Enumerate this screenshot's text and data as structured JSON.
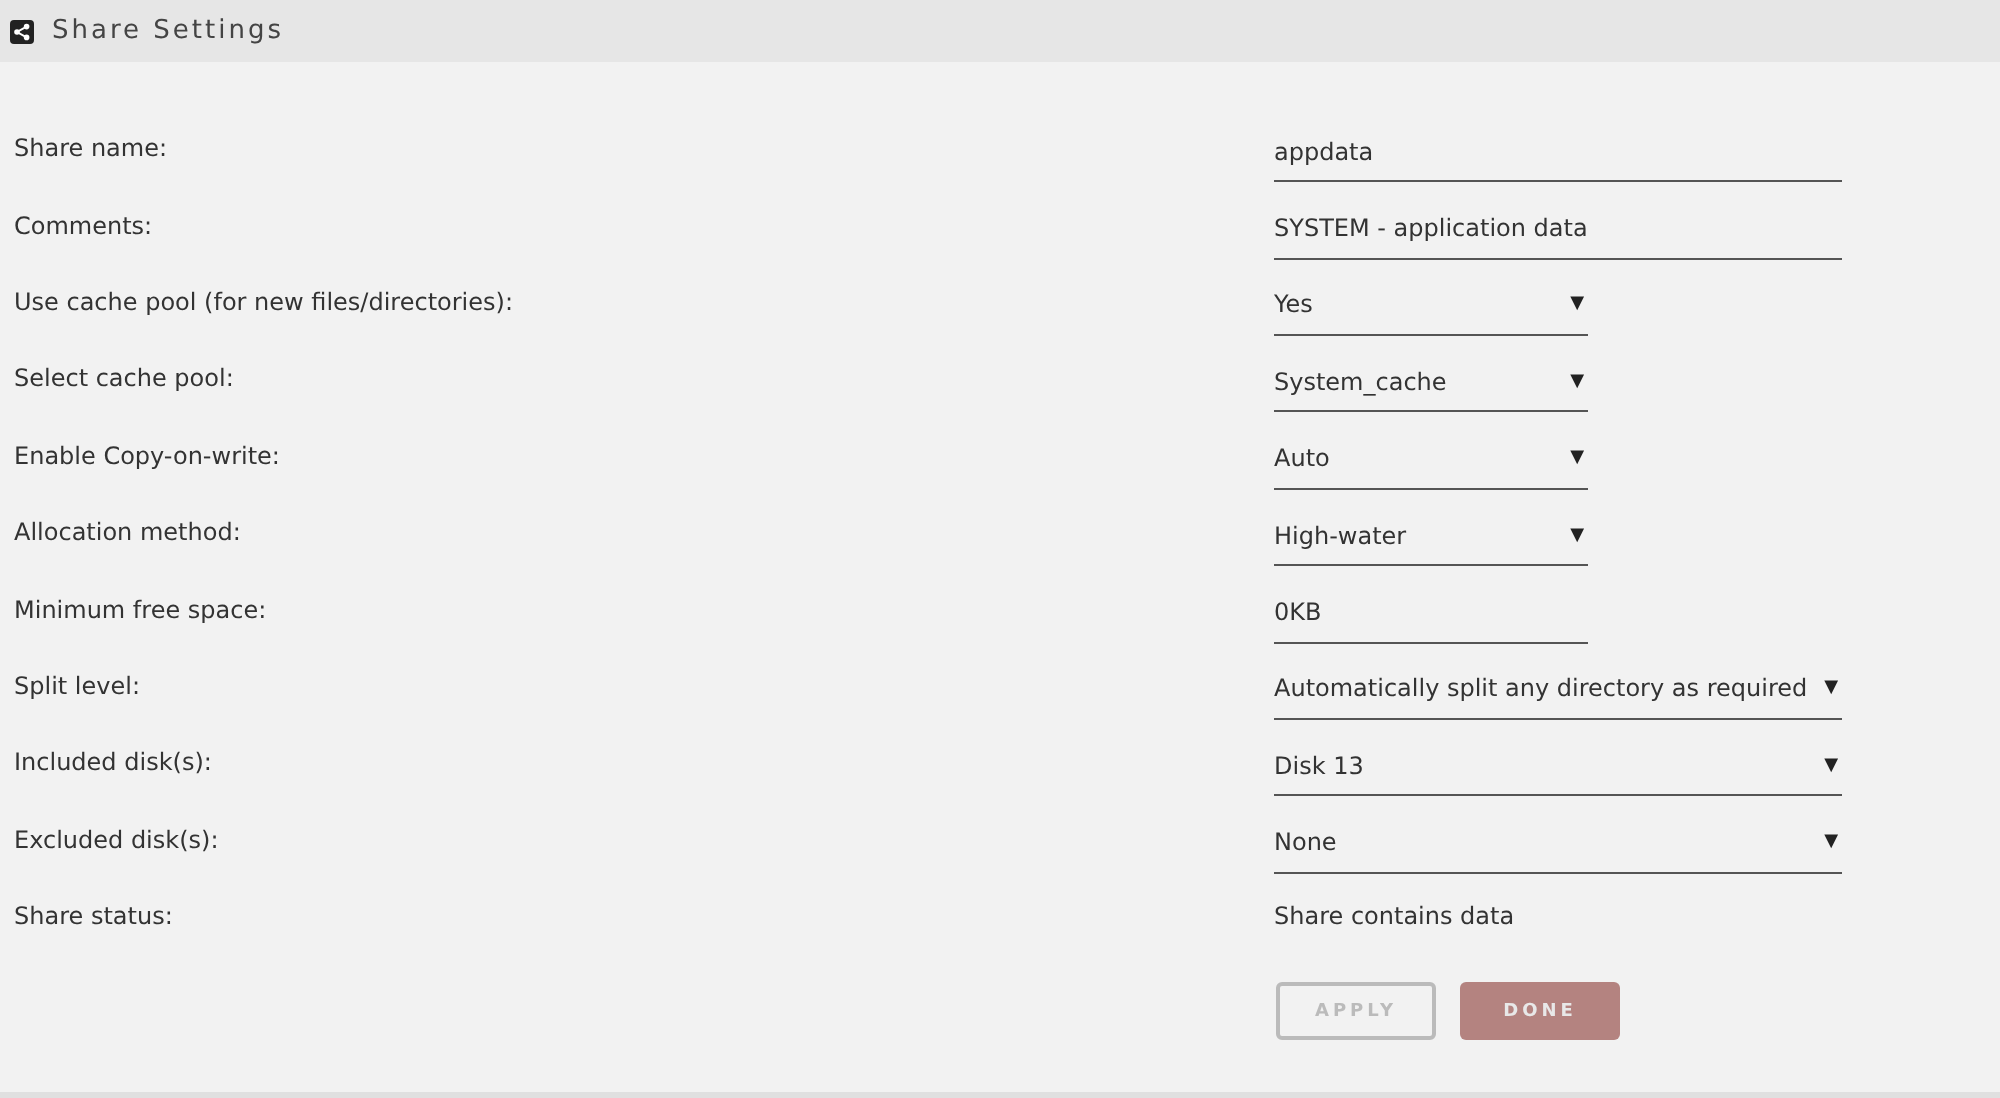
{
  "header": {
    "title": "Share Settings"
  },
  "fields": [
    {
      "label": "Share name:",
      "kind": "input",
      "value": "appdata"
    },
    {
      "label": "Comments:",
      "kind": "input",
      "value": "SYSTEM - application data"
    },
    {
      "label": "Use cache pool (for new files/directories):",
      "kind": "select",
      "value": "Yes",
      "arrow": "▼"
    },
    {
      "label": "Select cache pool:",
      "kind": "select",
      "value": "System_cache",
      "arrow": "▼"
    },
    {
      "label": "Enable Copy-on-write:",
      "kind": "select",
      "value": "Auto",
      "arrow": "▼"
    },
    {
      "label": "Allocation method:",
      "kind": "select",
      "value": "High-water",
      "arrow": "▼"
    },
    {
      "label": "Minimum free space:",
      "kind": "shortinput",
      "value": "0KB"
    },
    {
      "label": "Split level:",
      "kind": "wideselect",
      "value": "Automatically split any directory as required",
      "arrow": "▼"
    },
    {
      "label": "Included disk(s):",
      "kind": "wideselect",
      "value": "Disk 13",
      "arrow": "▼"
    },
    {
      "label": "Excluded disk(s):",
      "kind": "wideselect",
      "value": "None",
      "arrow": "▼"
    },
    {
      "label": "Share status:",
      "kind": "status",
      "value": "Share contains data"
    }
  ],
  "buttons": [
    {
      "label": "APPLY",
      "kind": "outline",
      "disabled": true
    },
    {
      "label": "DONE",
      "kind": "filled",
      "disabled": false
    }
  ]
}
